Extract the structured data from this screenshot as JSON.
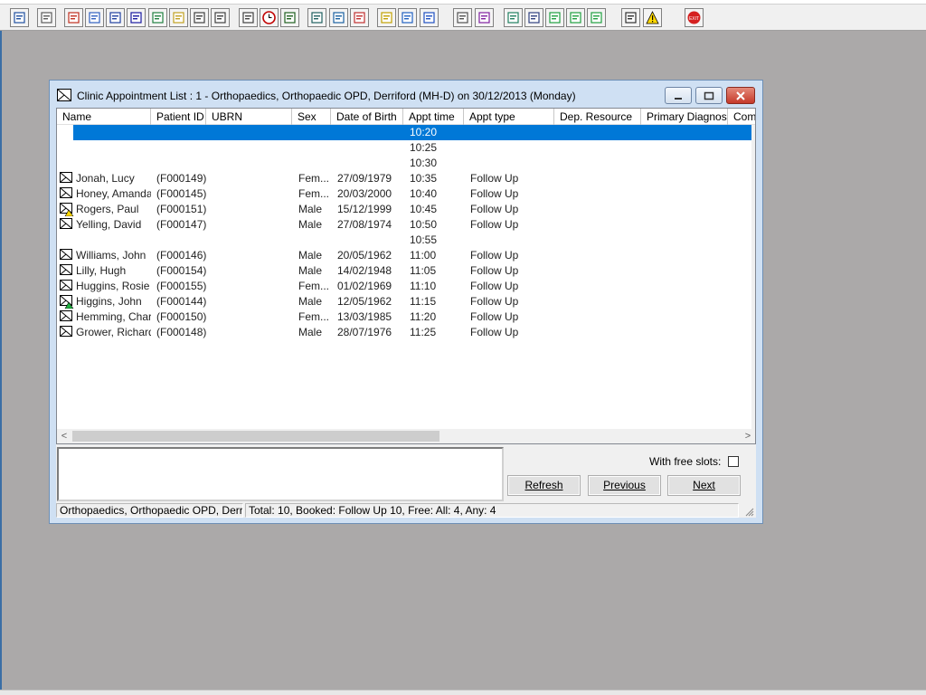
{
  "toolbar": {
    "icons": [
      "user-icon",
      "printer-icon",
      "book-icon",
      "edit-icon",
      "grid-icon",
      "mail-icon",
      "doctor-icon",
      "notepad-icon",
      "cards-icon",
      "flag-icon",
      "search-icon",
      "clock-icon",
      "monitor-icon",
      "certificate-icon",
      "card-edit-icon",
      "target-icon",
      "note-icon",
      "bed-icon",
      "ambulance-icon",
      "document-icon",
      "chart-icon",
      "globe-icon",
      "letter-icon",
      "tick-form-icon",
      "download-icon",
      "refresh-form-icon",
      "exchange-icon",
      "warning-icon",
      "exit-icon"
    ]
  },
  "window": {
    "title": "Clinic Appointment List : 1 - Orthopaedics, Orthopaedic OPD, Derriford (MH-D) on 30/12/2013 (Monday)",
    "minimize": "–",
    "maximize": "□",
    "close": "✕"
  },
  "list": {
    "columns": [
      "Name",
      "Patient ID",
      "UBRN",
      "Sex",
      "Date of Birth",
      "Appt time",
      "Appt type",
      "Dep. Resource",
      "Primary Diagnosis",
      "Comm"
    ],
    "rows": [
      {
        "name": "",
        "pid": "",
        "ubrn": "",
        "sex": "",
        "dob": "",
        "time": "10:20",
        "type": "",
        "icon": "",
        "selected": true
      },
      {
        "name": "",
        "pid": "",
        "ubrn": "",
        "sex": "",
        "dob": "",
        "time": "10:25",
        "type": "",
        "icon": ""
      },
      {
        "name": "",
        "pid": "",
        "ubrn": "",
        "sex": "",
        "dob": "",
        "time": "10:30",
        "type": "",
        "icon": ""
      },
      {
        "name": "Jonah, Lucy",
        "pid": "(F000149)",
        "ubrn": "",
        "sex": "Fem...",
        "dob": "27/09/1979",
        "time": "10:35",
        "type": "Follow Up",
        "icon": "appointment-icon"
      },
      {
        "name": "Honey, Amanda",
        "pid": "(F000145)",
        "ubrn": "",
        "sex": "Fem...",
        "dob": "20/03/2000",
        "time": "10:40",
        "type": "Follow Up",
        "icon": "appointment-icon"
      },
      {
        "name": "Rogers, Paul",
        "pid": "(F000151)",
        "ubrn": "",
        "sex": "Male",
        "dob": "15/12/1999",
        "time": "10:45",
        "type": "Follow Up",
        "icon": "appointment-warning-icon"
      },
      {
        "name": "Yelling, David",
        "pid": "(F000147)",
        "ubrn": "",
        "sex": "Male",
        "dob": "27/08/1974",
        "time": "10:50",
        "type": "Follow Up",
        "icon": "appointment-icon"
      },
      {
        "name": "",
        "pid": "",
        "ubrn": "",
        "sex": "",
        "dob": "",
        "time": "10:55",
        "type": "",
        "icon": ""
      },
      {
        "name": "Williams, John",
        "pid": "(F000146)",
        "ubrn": "",
        "sex": "Male",
        "dob": "20/05/1962",
        "time": "11:00",
        "type": "Follow Up",
        "icon": "appointment-icon"
      },
      {
        "name": "Lilly, Hugh",
        "pid": "(F000154)",
        "ubrn": "",
        "sex": "Male",
        "dob": "14/02/1948",
        "time": "11:05",
        "type": "Follow Up",
        "icon": "appointment-icon"
      },
      {
        "name": "Huggins, Rosie",
        "pid": "(F000155)",
        "ubrn": "",
        "sex": "Fem...",
        "dob": "01/02/1969",
        "time": "11:10",
        "type": "Follow Up",
        "icon": "appointment-icon"
      },
      {
        "name": "Higgins, John",
        "pid": "(F000144)",
        "ubrn": "",
        "sex": "Male",
        "dob": "12/05/1962",
        "time": "11:15",
        "type": "Follow Up",
        "icon": "appointment-ok-icon"
      },
      {
        "name": "Hemming, Char...",
        "pid": "(F000150)",
        "ubrn": "",
        "sex": "Fem...",
        "dob": "13/03/1985",
        "time": "11:20",
        "type": "Follow Up",
        "icon": "appointment-icon"
      },
      {
        "name": "Grower, Richard",
        "pid": "(F000148)",
        "ubrn": "",
        "sex": "Male",
        "dob": "28/07/1976",
        "time": "11:25",
        "type": "Follow Up",
        "icon": "appointment-icon"
      }
    ]
  },
  "controls": {
    "free_slots_label": "With free slots:",
    "free_slots_checked": false,
    "refresh_label": "Refresh",
    "previous_label": "Previous",
    "next_label": "Next"
  },
  "status": {
    "location": "Orthopaedics, Orthopaedic OPD, Derriford",
    "summary": "Total: 10, Booked: Follow Up 10, Free: All: 4, Any: 4"
  },
  "colors": {
    "selection": "#0078d7",
    "desktop": "#aba9a9",
    "window_frame": "#cfe0f3"
  }
}
